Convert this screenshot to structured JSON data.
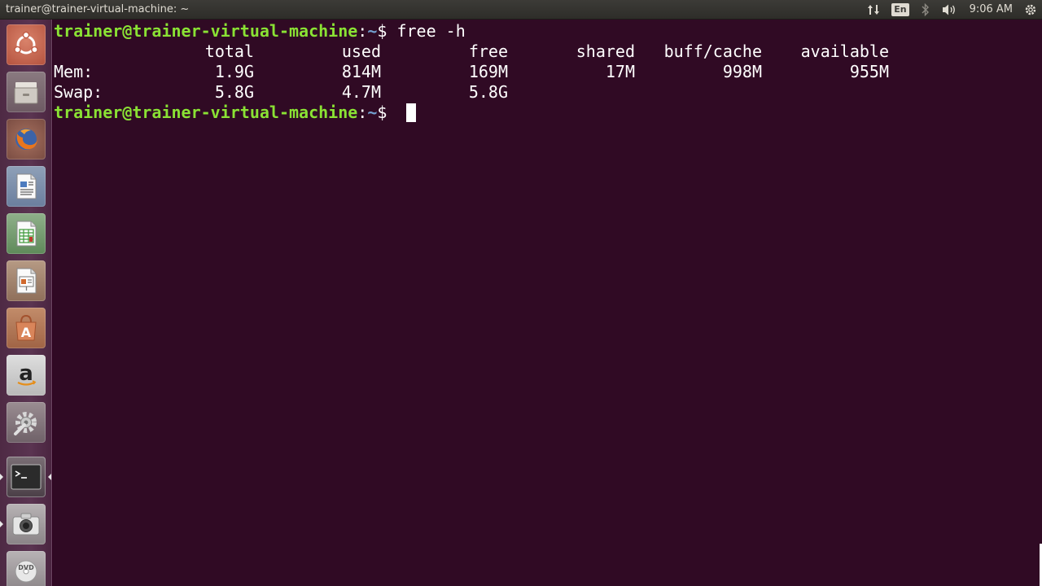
{
  "top_panel": {
    "window_title": "trainer@trainer-virtual-machine: ~",
    "indicators": {
      "network_icon": "network-updown-icon",
      "language": "En",
      "bluetooth_icon": "bluetooth-icon",
      "volume_icon": "volume-icon",
      "clock": "9:06 AM",
      "system_icon": "gear-power-icon"
    }
  },
  "launcher": {
    "items": [
      {
        "icon": "ubuntu-dash-icon"
      },
      {
        "icon": "file-manager-icon"
      },
      {
        "icon": "firefox-icon"
      },
      {
        "icon": "writer-icon"
      },
      {
        "icon": "calc-icon"
      },
      {
        "icon": "impress-icon"
      },
      {
        "icon": "software-center-icon"
      },
      {
        "icon": "amazon-icon"
      },
      {
        "icon": "system-settings-icon"
      },
      {
        "icon": "terminal-icon",
        "active": true
      },
      {
        "icon": "screenshot-icon"
      },
      {
        "icon": "dvd-icon"
      }
    ]
  },
  "terminal": {
    "prompt_user": "trainer@trainer-virtual-machine",
    "prompt_sep": ":",
    "prompt_path": "~",
    "prompt_dollar": "$ ",
    "command": "free -h",
    "table": {
      "headers": [
        "",
        "total",
        "used",
        "free",
        "shared",
        "buff/cache",
        "available"
      ],
      "rows": [
        [
          "Mem:",
          "1.9G",
          "814M",
          "169M",
          "17M",
          "998M",
          "955M"
        ],
        [
          "Swap:",
          "5.8G",
          "4.7M",
          "5.8G",
          "",
          "",
          ""
        ]
      ]
    }
  },
  "colors": {
    "terminal_bg": "#300a24",
    "prompt_green": "#8ae234",
    "prompt_blue": "#729fcf",
    "panel_bg": "#3c3b37"
  }
}
